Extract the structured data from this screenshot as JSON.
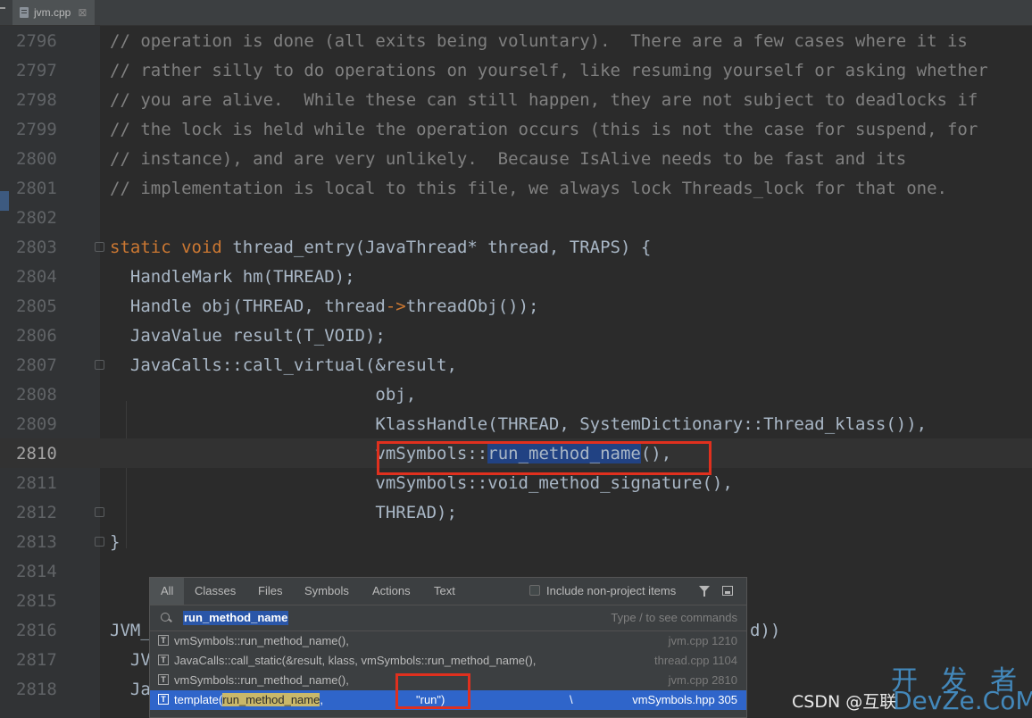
{
  "tab": {
    "filename": "jvm.cpp",
    "close": "⊠"
  },
  "editor": {
    "lines": [
      {
        "n": "2796",
        "c": "// operation is done (all exits being voluntary).  There are a few cases where it is"
      },
      {
        "n": "2797",
        "c": "// rather silly to do operations on yourself, like resuming yourself or asking whether"
      },
      {
        "n": "2798",
        "c": "// you are alive.  While these can still happen, they are not subject to deadlocks if"
      },
      {
        "n": "2799",
        "c": "// the lock is held while the operation occurs (this is not the case for suspend, for"
      },
      {
        "n": "2800",
        "c": "// instance), and are very unlikely.  Because IsAlive needs to be fast and its"
      },
      {
        "n": "2801",
        "c": "// implementation is local to this file, we always lock Threads_lock for that one."
      },
      {
        "n": "2802",
        "c": ""
      },
      {
        "n": "2803",
        "kw1": "static",
        "kw2": "void",
        "c": "thread_entry(JavaThread* thread, TRAPS) {"
      },
      {
        "n": "2804",
        "c": "  HandleMark hm(THREAD);"
      },
      {
        "n": "2805",
        "c1": "  Handle obj(THREAD, thread",
        "arrow": "->",
        "c2": "threadObj());"
      },
      {
        "n": "2806",
        "c": "  JavaValue result(T_VOID);"
      },
      {
        "n": "2807",
        "c": "  JavaCalls::call_virtual(&result,"
      },
      {
        "n": "2808",
        "c": "                          obj,"
      },
      {
        "n": "2809",
        "c": "                          KlassHandle(THREAD, SystemDictionary::Thread_klass()),"
      },
      {
        "n": "2810",
        "c1": "                          vmSymbols::",
        "selected": "run_method_name",
        "c2": "(),"
      },
      {
        "n": "2811",
        "c": "                          vmSymbols::void_method_signature(),"
      },
      {
        "n": "2812",
        "c": "                          THREAD);"
      },
      {
        "n": "2813",
        "c": "}"
      },
      {
        "n": "2814",
        "c": ""
      },
      {
        "n": "2815",
        "c": ""
      },
      {
        "n": "2816",
        "c": "JVM_",
        "tail": "d))"
      },
      {
        "n": "2817",
        "c": "  JV"
      },
      {
        "n": "2818",
        "c": "  Ja"
      }
    ]
  },
  "popup": {
    "tabs": [
      "All",
      "Classes",
      "Files",
      "Symbols",
      "Actions",
      "Text"
    ],
    "include_label": "Include non-project items",
    "search_value": "run_method_name",
    "search_hint": "Type / to see commands",
    "results": [
      {
        "icon": "T",
        "text": "vmSymbols::run_method_name(),",
        "loc": "jvm.cpp 1210"
      },
      {
        "icon": "T",
        "text": "JavaCalls::call_static(&result, klass, vmSymbols::run_method_name(),",
        "loc": "thread.cpp 1104"
      },
      {
        "icon": "T",
        "text": "vmSymbols::run_method_name(),",
        "loc": "jvm.cpp 2810"
      },
      {
        "icon": "T",
        "pre": "template(",
        "hl": "run_method_name",
        "post": ",",
        "str": "\"run\")",
        "bs": "\\",
        "loc": "vmSymbols.hpp 305"
      }
    ]
  },
  "watermark": {
    "csdn": "CSDN @互联",
    "site_top": "开 发 者",
    "site": "DevZe.CoM"
  },
  "colors": {
    "accent": "#2f65ca",
    "highlight_box": "#e0301e",
    "selection": "#214283",
    "keyword": "#cc7832"
  }
}
